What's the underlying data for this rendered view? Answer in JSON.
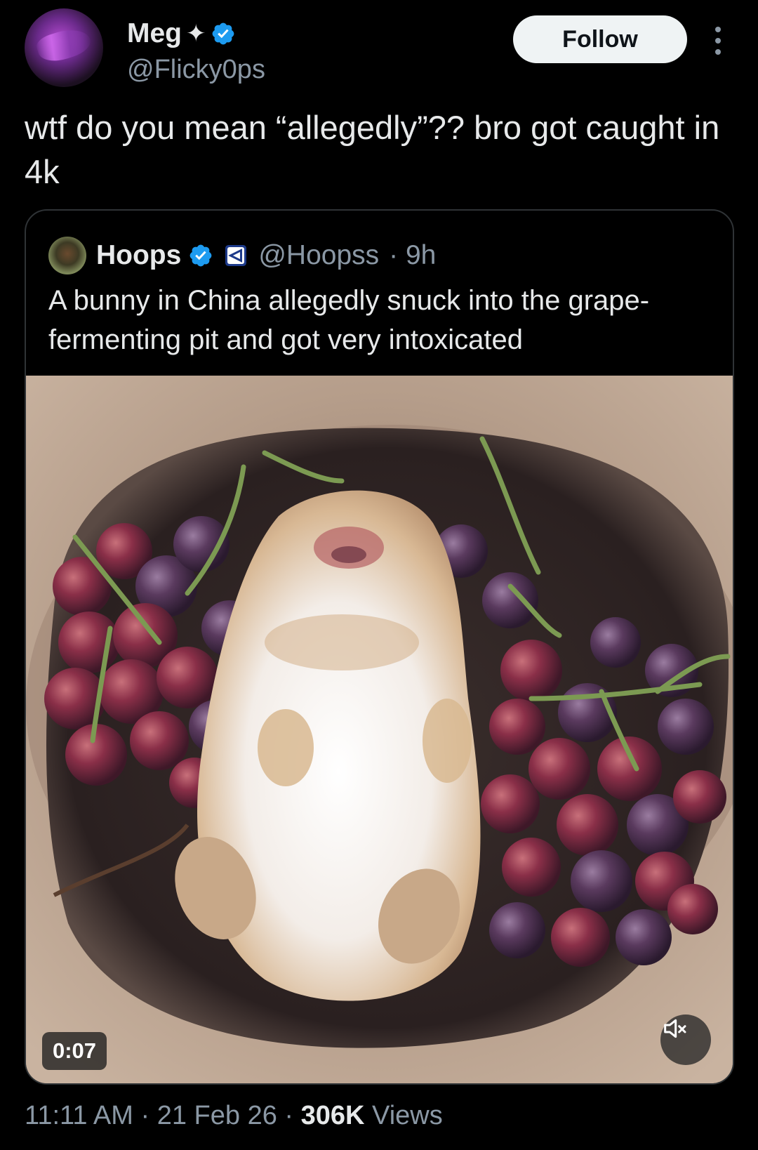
{
  "author": {
    "name": "Meg",
    "handle": "@Flicky0ps",
    "follow_label": "Follow"
  },
  "tweet": {
    "text": "wtf do you mean “allegedly”?? bro got caught in 4k"
  },
  "quoted": {
    "name": "Hoops",
    "handle": "@Hoopss",
    "time": "· 9h",
    "text": "A bunny in China allegedly snuck into the grape-fermenting pit and got very intoxicated",
    "video": {
      "timestamp": "0:07"
    }
  },
  "meta": {
    "time": "11:11 AM",
    "date": "21 Feb 26",
    "views_count": "306K",
    "views_label": "Views"
  },
  "colors": {
    "background": "#000000",
    "text": "#e7e9ea",
    "secondary_text": "#8b98a5",
    "verified": "#1d9bf0",
    "follow_button": "#eff3f4",
    "border": "#2f3336"
  },
  "icons": {
    "sparkle": "sparkle-icon",
    "verified": "verified-badge-icon",
    "more": "more-options-icon",
    "affiliate": "affiliate-badge-icon",
    "mute": "speaker-muted-icon"
  }
}
